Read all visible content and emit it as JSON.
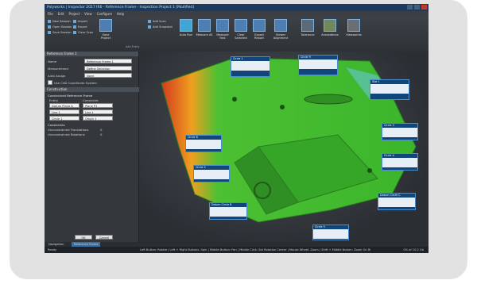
{
  "window": {
    "title": "Polyworks | Inspector 2017 IR6 - Reference Frame - Inspection Project 1 [Modified]"
  },
  "menu": [
    "File",
    "Edit",
    "Project",
    "View",
    "Configure",
    "Help"
  ],
  "ribbon": {
    "session": [
      "New Session",
      "Open Session",
      "Save Session"
    ],
    "edit": [
      "Import",
      "Export",
      "Clear Scan"
    ],
    "save_project": "Save Project",
    "add_geometry": [
      "Add Scan",
      "Add Snapshot"
    ],
    "add_geometry_group": "Add Entity",
    "tools": [
      "Auto Run",
      "Measure All",
      "Measure Fast",
      "Clear Selected",
      "Export Report",
      "Viewer Alignment"
    ],
    "right": [
      "Tolerance",
      "Annotations",
      "Viewpoints"
    ]
  },
  "panel": {
    "header": "Reference Frame 1",
    "fields": [
      {
        "label": "Name",
        "value": "Reference Frame 1"
      },
      {
        "label": "Measurement",
        "value": "Define Selection"
      },
      {
        "label": "Auto Assign",
        "value": "None"
      }
    ],
    "checkbox": "Use CAD Coordinate System",
    "construction_header": "Construction",
    "constrained_title": "Constrained Reference Frame",
    "table_headers": [
      "Entity",
      "Constraint"
    ],
    "rows": [
      [
        "Datum Plane A",
        "Plane P1"
      ],
      [
        "Line 1",
        "Line 1"
      ],
      [
        "Circle 1",
        "Origin 1"
      ]
    ],
    "info_title": "Constraints",
    "info_rows": [
      [
        "Unconstrained Translations",
        "0"
      ],
      [
        "Unconstrained Rotations",
        "0"
      ]
    ],
    "ok": "OK",
    "cancel": "Cancel"
  },
  "labels": [
    "Circle 1",
    "Circle 9",
    "Slot 1",
    "Circle 3",
    "Circle 4",
    "Circle 6",
    "Circle 2",
    "Datum Circle B",
    "Datum Circle C",
    "Circle 5"
  ],
  "nav_tabs": [
    "Navigation",
    "Reference Frame"
  ],
  "status": {
    "ready": "Ready",
    "hints": "Left Button: Rotate | Left + Right Buttons: Spin | Middle Button: Pan | Middle Click: Set Rotation Center | Mouse Wheel: Zoom | Shift + Middle Button: Zoom On Region",
    "zoom": "0% of 10,2 Gb"
  }
}
